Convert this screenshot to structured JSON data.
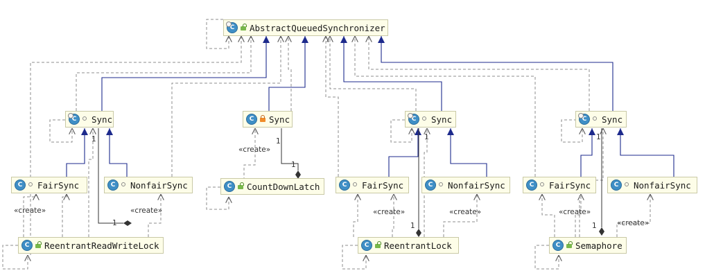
{
  "nodes": {
    "aqs": "AbstractQueuedSynchronizer",
    "sync_rrwl": "Sync",
    "fair_rrwl": "FairSync",
    "nonfair_rrwl": "NonfairSync",
    "rrwl": "ReentrantReadWriteLock",
    "sync_cdl": "Sync",
    "cdl": "CountDownLatch",
    "sync_rl": "Sync",
    "fair_rl": "FairSync",
    "nonfair_rl": "NonfairSync",
    "rl": "ReentrantLock",
    "sync_sem": "Sync",
    "fair_sem": "FairSync",
    "nonfair_sem": "NonfairSync",
    "sem": "Semaphore"
  },
  "labels": {
    "create": "«create»",
    "one": "1"
  },
  "colors": {
    "extends_line": "#1d2a8c",
    "dependency_line": "#8c8c8c",
    "node_fill": "#fdfde8"
  },
  "icons": {
    "class": "class-icon",
    "abstract_marker": "abstract-marker-icon",
    "package_visibility": "package-visibility-icon",
    "private_visibility": "lock-icon",
    "public_visibility": "open-lock-icon"
  }
}
